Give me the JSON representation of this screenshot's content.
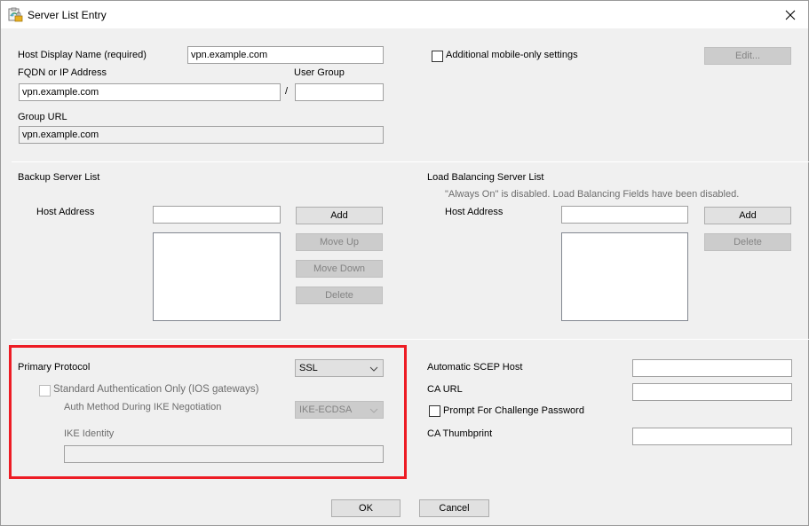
{
  "window": {
    "title": "Server List Entry",
    "icon": "server-list-app-icon",
    "close_icon": "close-icon"
  },
  "general": {
    "host_display_name_label": "Host Display Name (required)",
    "host_display_name_value": "vpn.example.com",
    "fqdn_label": "FQDN or IP Address",
    "fqdn_value": "vpn.example.com",
    "slash": "/",
    "user_group_label": "User Group",
    "user_group_value": "",
    "group_url_label": "Group URL",
    "group_url_value": "vpn.example.com",
    "mobile_settings_label": "Additional mobile-only settings",
    "mobile_settings_checked": false,
    "edit_button": "Edit..."
  },
  "backup": {
    "title": "Backup Server List",
    "host_address_label": "Host Address",
    "host_address_value": "",
    "items": [],
    "add_button": "Add",
    "move_up_button": "Move Up",
    "move_down_button": "Move Down",
    "delete_button": "Delete"
  },
  "load_balancing": {
    "title": "Load Balancing Server List",
    "notice": "\"Always On\" is disabled.  Load Balancing Fields have been disabled.",
    "host_address_label": "Host Address",
    "host_address_value": "",
    "items": [],
    "add_button": "Add",
    "delete_button": "Delete"
  },
  "protocol": {
    "primary_protocol_label": "Primary Protocol",
    "primary_protocol_value": "SSL",
    "standard_auth_label": "Standard Authentication Only (IOS gateways)",
    "standard_auth_checked": false,
    "auth_method_label": "Auth Method During IKE Negotiation",
    "auth_method_value": "IKE-ECDSA",
    "ike_identity_label": "IKE Identity",
    "ike_identity_value": "",
    "highlight_color": "#ed1c24"
  },
  "scep": {
    "auto_scep_host_label": "Automatic SCEP Host",
    "auto_scep_host_value": "",
    "ca_url_label": "CA URL",
    "ca_url_value": "",
    "prompt_challenge_label": "Prompt For Challenge Password",
    "prompt_challenge_checked": false,
    "ca_thumbprint_label": "CA Thumbprint",
    "ca_thumbprint_value": ""
  },
  "footer": {
    "ok_button": "OK",
    "cancel_button": "Cancel"
  }
}
